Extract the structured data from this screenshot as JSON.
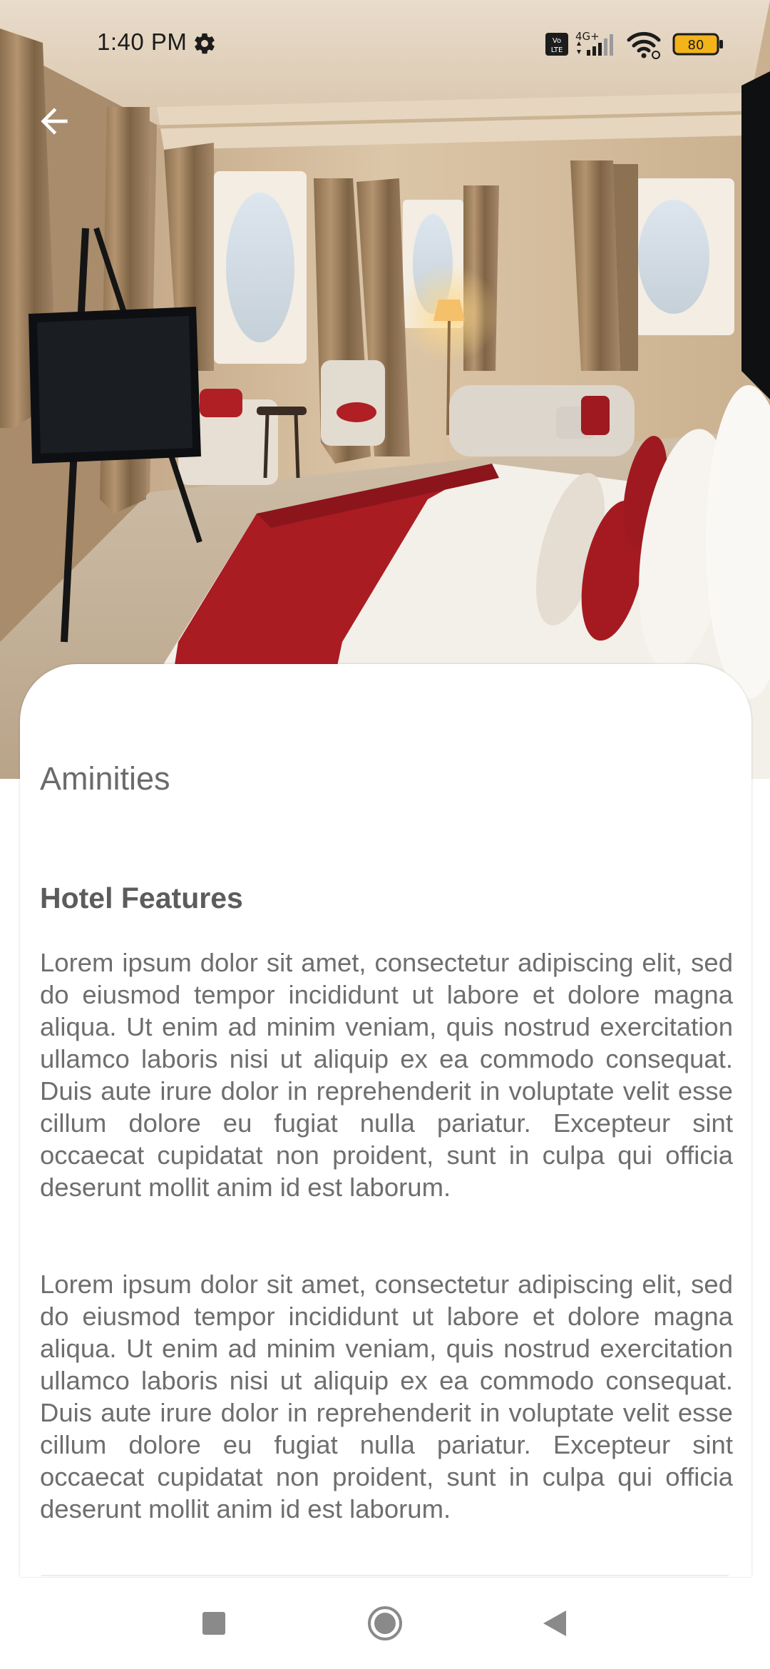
{
  "status_bar": {
    "time": "1:40 PM",
    "network_badge": "Vo LTE",
    "network_type": "4G+",
    "battery_level": "80",
    "icons": [
      "gear-icon",
      "volte-icon",
      "signal-icon",
      "wifi-icon",
      "battery-icon"
    ]
  },
  "header": {
    "back_icon": "arrow-left-icon"
  },
  "content": {
    "section_title": "Aminities",
    "features_heading": "Hotel Features",
    "paragraphs": [
      "Lorem ipsum dolor sit amet, consectetur adipiscing elit, sed do eiusmod tempor incididunt ut labore et dolore magna aliqua. Ut enim ad minim veniam, quis nostrud exercitation ullamco laboris nisi ut aliquip ex ea commodo consequat. Duis aute irure dolor in reprehenderit in voluptate velit esse cillum dolore eu fugiat nulla pariatur. Excepteur sint occaecat cupidatat non proident, sunt in culpa qui officia deserunt mollit anim id est laborum.",
      "Lorem ipsum dolor sit amet, consectetur adipiscing elit, sed do eiusmod tempor incididunt ut labore et dolore magna aliqua. Ut enim ad minim veniam, quis nostrud exercitation ullamco laboris nisi ut aliquip ex ea commodo consequat. Duis aute irure dolor in reprehenderit in voluptate velit esse cillum dolore eu fugiat nulla pariatur. Excepteur sint occaecat cupidatat non proident, sunt in culpa qui officia deserunt mollit anim id est laborum."
    ]
  },
  "nav_bar": {
    "icons": [
      "recent-apps-icon",
      "home-icon",
      "back-triangle-icon"
    ]
  },
  "colors": {
    "text_primary": "#5c5c5c",
    "text_body": "#6e6e6e",
    "battery_fill": "#f2b31b",
    "accent_red": "#b01f24"
  }
}
